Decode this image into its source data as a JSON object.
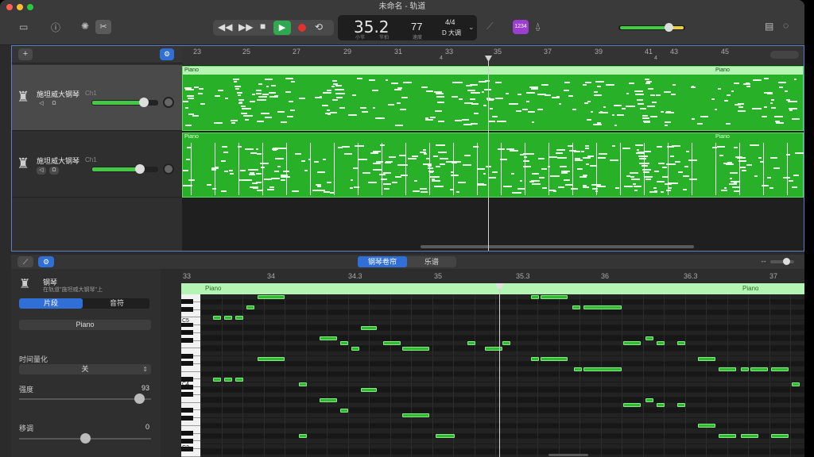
{
  "window": {
    "title": "未命名 - 轨道"
  },
  "lcd": {
    "position": "35.2",
    "bar_label": "小节",
    "beat_label": "节拍",
    "tempo": "77",
    "tempo_label": "速度",
    "signature": "4/4",
    "key": "D 大调"
  },
  "toolbar": {
    "count_in": "1234"
  },
  "ruler": {
    "bars": [
      "23",
      "25",
      "27",
      "29",
      "31",
      "33",
      "35",
      "37",
      "39",
      "41",
      "43",
      "45"
    ],
    "sig_marks": [
      "4",
      "4"
    ]
  },
  "tracks": [
    {
      "name": "施坦威大钢琴",
      "channel": "Ch1",
      "volume": 0.85,
      "region_label_left": "Piano",
      "region_label_right": "Piano"
    },
    {
      "name": "施坦威大钢琴",
      "channel": "Ch1",
      "volume": 0.8,
      "region_label_left": "Piano",
      "region_label_right": "Piano"
    }
  ],
  "editor": {
    "tabs": [
      "钢琴卷帘",
      "乐谱"
    ],
    "inspector": {
      "instrument": "钢琴",
      "subtitle": "在轨道\"施坦威大钢琴\"上",
      "segments": [
        "片段",
        "音符"
      ],
      "region_name": "Piano",
      "quantize_label": "时间量化",
      "quantize_value": "关",
      "velocity_label": "强度",
      "velocity_value": "93",
      "transpose_label": "移调",
      "transpose_value": "0"
    },
    "ruler": [
      "33",
      "34",
      "34.3",
      "35",
      "35.3",
      "36",
      "36.3",
      "37"
    ],
    "region_label_left": "Piano",
    "region_label_right": "Piano",
    "key_labels": [
      "C5",
      "C4",
      "C3"
    ]
  },
  "colors": {
    "region": "#28b028",
    "region_bar": "#b4f5b4",
    "accent": "#2f6fd6",
    "play": "#2fa84f",
    "record": "#e0322e"
  }
}
